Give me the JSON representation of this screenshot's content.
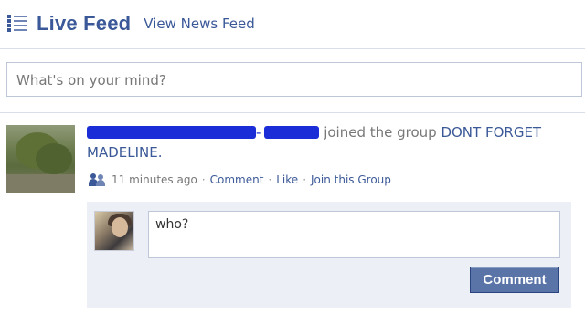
{
  "header": {
    "title": "Live Feed",
    "view_link": "View News Feed"
  },
  "status": {
    "placeholder": "What's on your mind?"
  },
  "story": {
    "action_text": " joined the group ",
    "group_name": "DONT FORGET MADELINE.",
    "timestamp": "11 minutes ago",
    "actions": [
      "Comment",
      "Like",
      "Join this Group"
    ],
    "separator": "·"
  },
  "comment": {
    "draft": "who?",
    "button_label": "Comment"
  },
  "colors": {
    "brand": "#3b5998",
    "redaction": "#1a2dd6",
    "panel": "#eceff5"
  },
  "icons": {
    "header": "feed-list-icon",
    "meta": "group-people-icon"
  }
}
